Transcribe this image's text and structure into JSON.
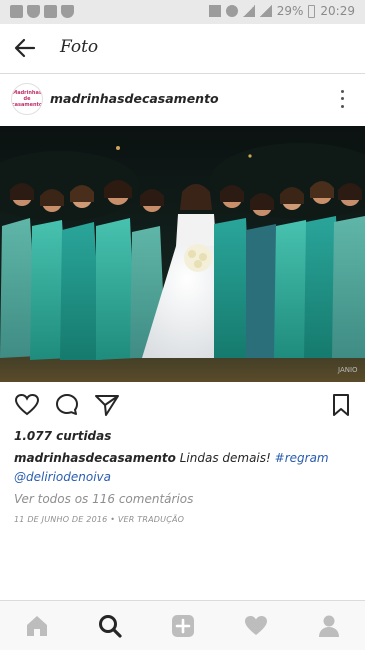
{
  "status_bar": {
    "battery": "29%",
    "time": "20:29"
  },
  "header": {
    "title": "Foto"
  },
  "post": {
    "username": "madrinhasdecasamento",
    "avatar_text": "Madrinhas de casamento",
    "likes": "1.077 curtidas",
    "caption_user": "madrinhasdecasamento",
    "caption_text": " Lindas demais! ",
    "caption_hashtag": "#regram",
    "caption_mention": "@deliriodenoiva",
    "view_comments": "Ver todos os 116 comentários",
    "date": "11 DE JUNHO DE 2016",
    "separator": " • ",
    "translate": "VER TRADUÇÃO",
    "photo_watermark": "JANIO"
  },
  "colors": {
    "link": "#2a5db0",
    "muted": "#8e8e8e",
    "dress_teal": "#3fb7a6",
    "border": "#dbdbdb"
  },
  "icons": {
    "back": "back-arrow-icon",
    "more": "more-vertical-icon",
    "like": "heart-icon",
    "comment": "comment-bubble-icon",
    "share": "paper-plane-icon",
    "save": "bookmark-icon",
    "nav": [
      "home-icon",
      "search-icon",
      "add-post-icon",
      "activity-heart-icon",
      "profile-icon"
    ]
  }
}
